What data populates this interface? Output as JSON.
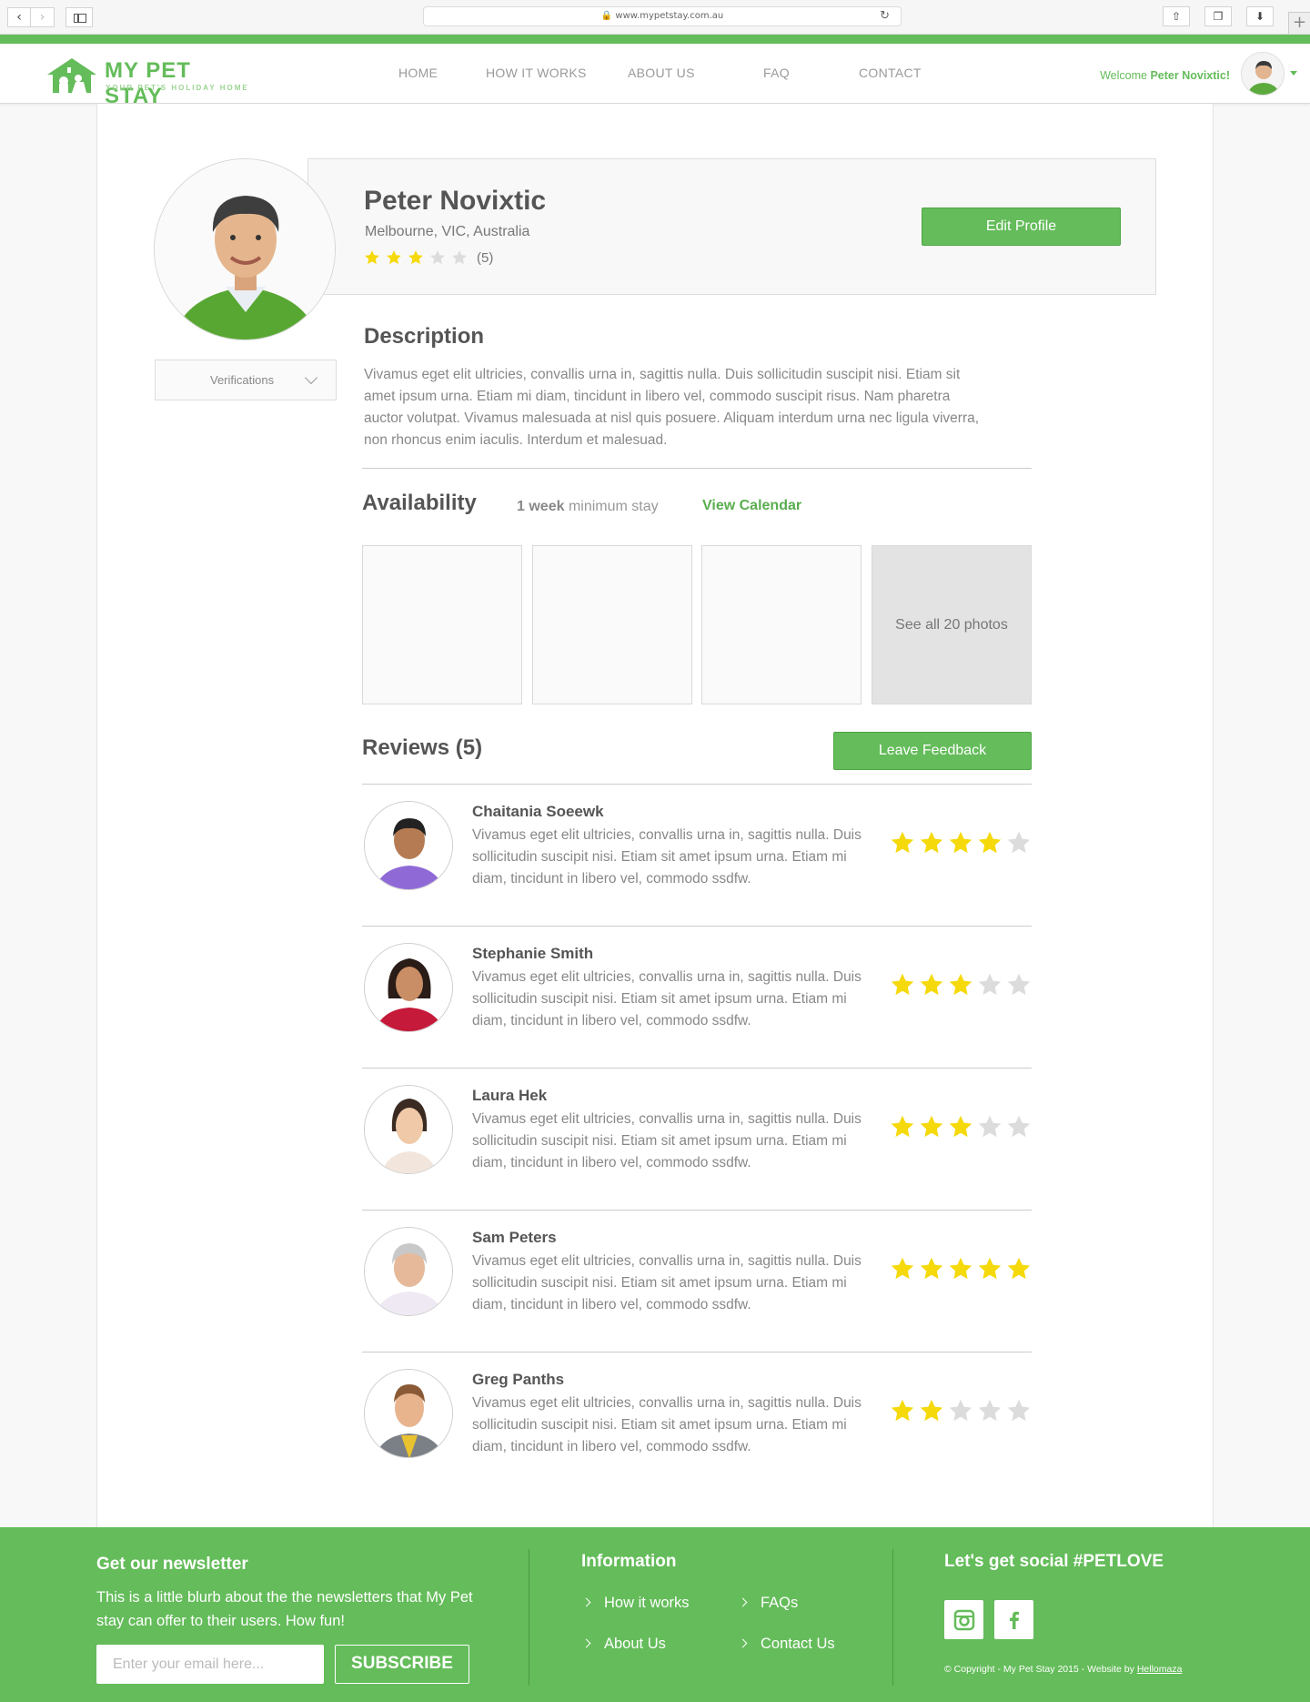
{
  "browser": {
    "url": "www.mypetstay.com.au"
  },
  "brand": {
    "name": "MY PET STAY",
    "tagline": "YOUR PET'S HOLIDAY HOME",
    "accent": "#64bc5a"
  },
  "nav": {
    "items": [
      {
        "label": "HOME"
      },
      {
        "label": "HOW IT WORKS"
      },
      {
        "label": "ABOUT US"
      },
      {
        "label": "FAQ"
      },
      {
        "label": "CONTACT"
      }
    ]
  },
  "user": {
    "welcome_prefix": "Welcome",
    "welcome_name": "Peter Novixtic!"
  },
  "profile": {
    "name": "Peter Novixtic",
    "location": "Melbourne, VIC, Australia",
    "rating": 3,
    "rating_max": 5,
    "rating_count": "(5)",
    "edit_label": "Edit Profile",
    "verifications_label": "Verifications"
  },
  "description": {
    "heading": "Description",
    "text": "Vivamus eget elit ultricies, convallis urna in, sagittis nulla. Duis sollicitudin suscipit nisi. Etiam sit amet ipsum urna. Etiam mi diam, tincidunt in libero vel, commodo suscipit risus. Nam pharetra auctor volutpat. Vivamus malesuada at nisl quis posuere. Aliquam interdum urna nec ligula viverra, non rhoncus enim iaculis. Interdum et malesuad."
  },
  "availability": {
    "heading": "Availability",
    "min_value": "1 week",
    "min_suffix": "minimum stay",
    "calendar_link": "View Calendar"
  },
  "photos": {
    "see_all": "See all 20 photos"
  },
  "reviews": {
    "heading": "Reviews (5)",
    "feedback_label": "Leave Feedback",
    "items": [
      {
        "name": "Chaitania Soeewk",
        "text": "Vivamus eget elit ultricies, convallis urna in, sagittis nulla. Duis sollicitudin suscipit nisi. Etiam sit amet ipsum urna. Etiam mi diam, tincidunt in libero vel, commodo ssdfw.",
        "rating": 4
      },
      {
        "name": "Stephanie Smith",
        "text": "Vivamus eget elit ultricies, convallis urna in, sagittis nulla. Duis sollicitudin suscipit nisi. Etiam sit amet ipsum urna. Etiam mi diam, tincidunt in libero vel, commodo ssdfw.",
        "rating": 3
      },
      {
        "name": "Laura Hek",
        "text": "Vivamus eget elit ultricies, convallis urna in, sagittis nulla. Duis sollicitudin suscipit nisi. Etiam sit amet ipsum urna. Etiam mi diam, tincidunt in libero vel, commodo ssdfw.",
        "rating": 3
      },
      {
        "name": "Sam Peters",
        "text": "Vivamus eget elit ultricies, convallis urna in, sagittis nulla. Duis sollicitudin suscipit nisi. Etiam sit amet ipsum urna. Etiam mi diam, tincidunt in libero vel, commodo ssdfw.",
        "rating": 5
      },
      {
        "name": "Greg Panths",
        "text": "Vivamus eget elit ultricies, convallis urna in, sagittis nulla. Duis sollicitudin suscipit nisi. Etiam sit amet ipsum urna. Etiam mi diam, tincidunt in libero vel, commodo ssdfw.",
        "rating": 2
      }
    ]
  },
  "footer": {
    "newsletter_heading": "Get our newsletter",
    "newsletter_blurb": "This is a little blurb about the the newsletters that My Pet stay can offer to their users. How fun!",
    "email_placeholder": "Enter your email here...",
    "subscribe_label": "SUBSCRIBE",
    "info_heading": "Information",
    "links": [
      {
        "label": "How it works"
      },
      {
        "label": "FAQs"
      },
      {
        "label": "About Us"
      },
      {
        "label": "Contact Us"
      }
    ],
    "social_heading": "Let's get social #PETLOVE",
    "social_icons": [
      "instagram-icon",
      "facebook-icon"
    ],
    "copyright": "© Copyright - My Pet Stay 2015 - Website by",
    "credit": "Hellomaza"
  },
  "colors": {
    "star_on": "#f5d90a",
    "star_off": "#dcdcdc"
  }
}
